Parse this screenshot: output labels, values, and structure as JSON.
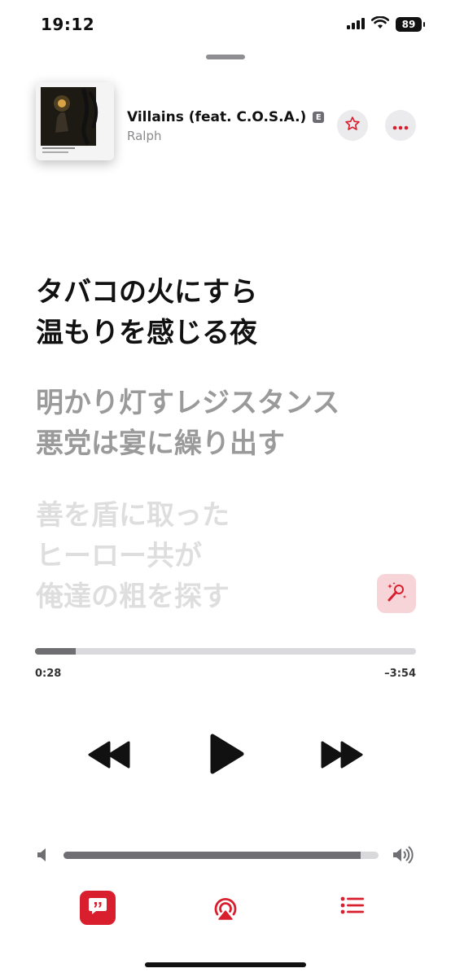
{
  "status_bar": {
    "time": "19:12",
    "battery": "89",
    "icons": [
      "cellular-signal-icon",
      "wifi-icon",
      "battery-icon"
    ]
  },
  "now_playing": {
    "title": "Villains (feat. C.O.S.A.)",
    "explicit_badge": "E",
    "artist": "Ralph",
    "artwork_icon": "album-artwork",
    "favorite_icon": "star-icon",
    "more_icon": "ellipsis-icon"
  },
  "lyrics": {
    "current": [
      "タバコの火にすら",
      "温もりを感じる夜"
    ],
    "next": [
      "明かり灯すレジスタンス",
      "悪党は宴に繰り出す"
    ],
    "later": [
      "善を盾に取った",
      "ヒーロー共が",
      "俺達の粗を探す"
    ],
    "sing_icon": "sparkle-microphone-icon"
  },
  "progress": {
    "elapsed": "0:28",
    "remaining": "–3:54",
    "fraction": 0.107
  },
  "transport": {
    "rewind_icon": "rewind-icon",
    "play_icon": "play-icon",
    "forward_icon": "fast-forward-icon"
  },
  "volume": {
    "level": 0.943,
    "low_icon": "speaker-low-icon",
    "high_icon": "speaker-high-icon"
  },
  "bottom_bar": {
    "lyrics_icon": "lyrics-quote-bubble-icon",
    "airplay_icon": "airplay-audio-icon",
    "queue_icon": "queue-list-icon"
  },
  "colors": {
    "accent": "#d91f2e",
    "sing_bg": "#f6d4d8",
    "current_lyric": "#111111",
    "next_lyric": "#9a9a9a",
    "later_lyric": "#dedede"
  }
}
